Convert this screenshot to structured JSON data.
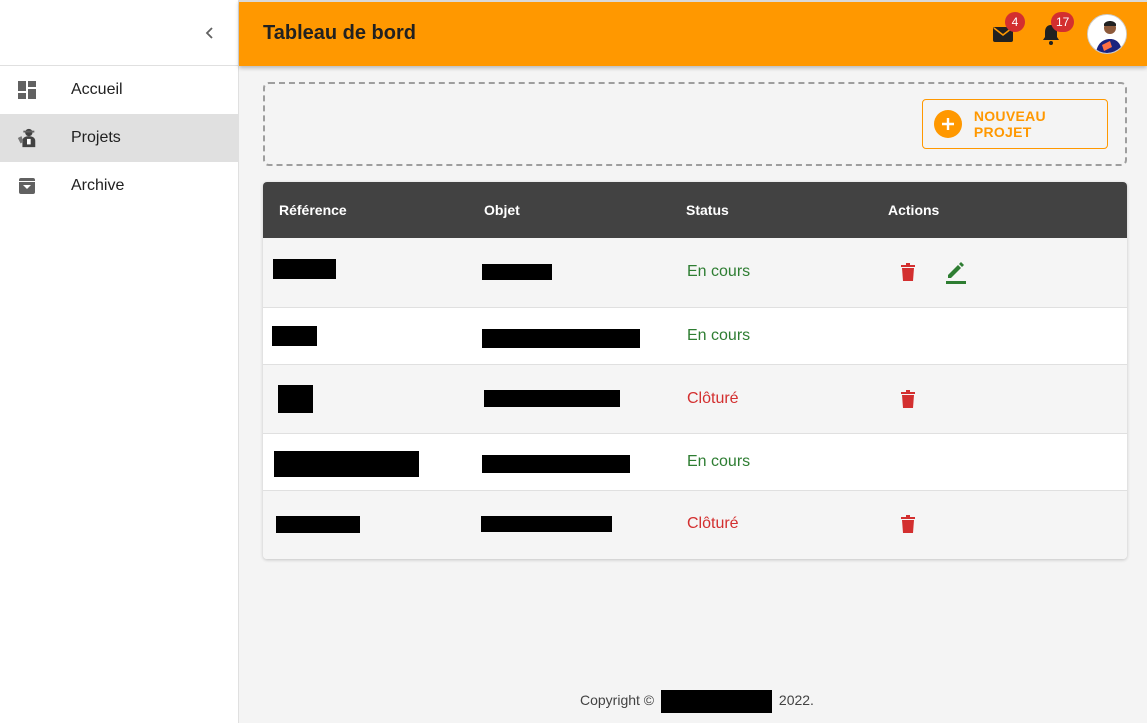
{
  "sidebar": {
    "collapse_icon": "chevron-left-icon",
    "items": [
      {
        "label": "Accueil",
        "icon": "dashboard-icon",
        "active": false
      },
      {
        "label": "Projets",
        "icon": "engineer-icon",
        "active": true
      },
      {
        "label": "Archive",
        "icon": "archive-icon",
        "active": false
      }
    ]
  },
  "header": {
    "title": "Tableau de bord",
    "mail_count": "4",
    "notification_count": "17",
    "bg_color": "#ff9800"
  },
  "toolbar": {
    "new_project_label": "NOUVEAU PROJET"
  },
  "table": {
    "columns": [
      "Référence",
      "Objet",
      "Status",
      "Actions"
    ],
    "rows": [
      {
        "reference": "[redacted]",
        "objet": "[redacted]",
        "status": "En cours",
        "state": "open",
        "actions": [
          "delete",
          "edit"
        ]
      },
      {
        "reference": "[redacted]",
        "objet": "[redacted]",
        "status": "En cours",
        "state": "open",
        "actions": []
      },
      {
        "reference": "[redacted]",
        "objet": "[redacted]",
        "status": "Clôturé",
        "state": "closed",
        "actions": [
          "delete"
        ]
      },
      {
        "reference": "[redacted]",
        "objet": "[redacted]",
        "status": "En cours",
        "state": "open",
        "actions": []
      },
      {
        "reference": "[redacted]",
        "objet": "[redacted]",
        "status": "Clôturé",
        "state": "closed",
        "actions": [
          "delete"
        ]
      }
    ]
  },
  "footer": {
    "prefix": "Copyright ©",
    "suffix": "2022."
  },
  "colors": {
    "accent": "#ff9800",
    "status_open": "#2e7d32",
    "status_closed": "#d32f2f",
    "table_header": "#424242"
  }
}
